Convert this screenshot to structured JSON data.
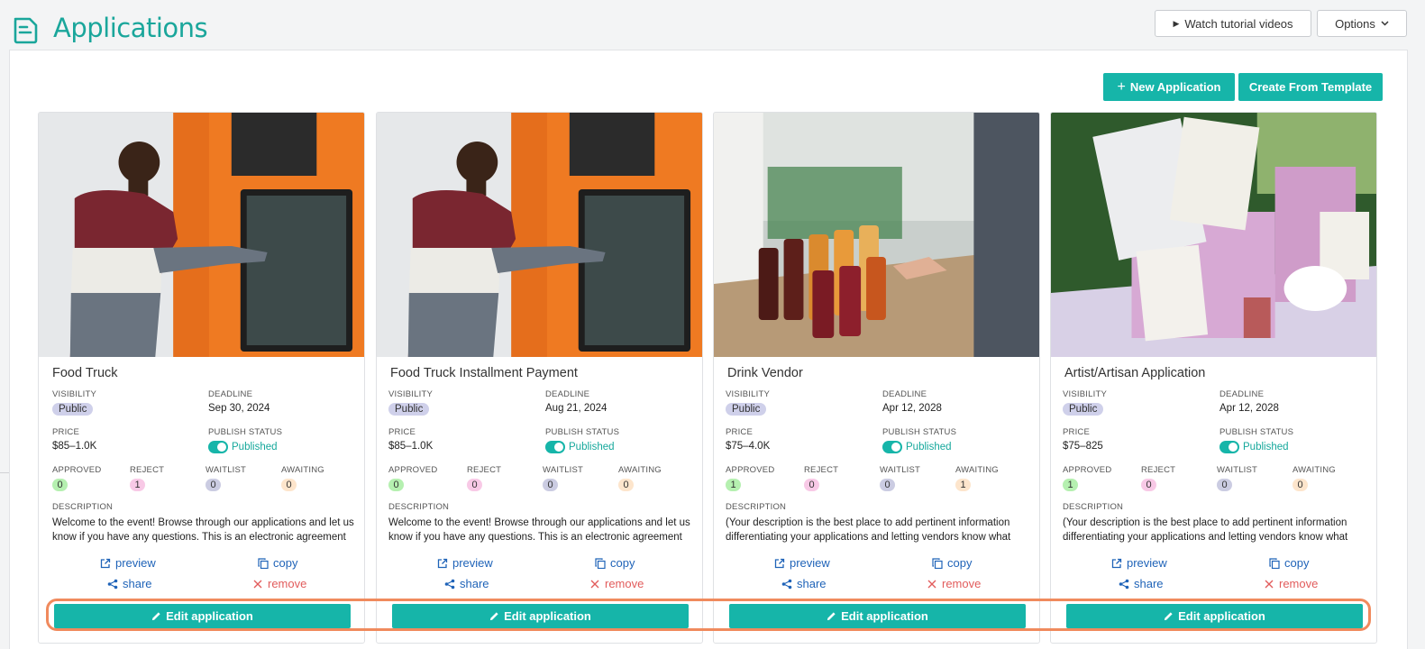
{
  "header": {
    "title": "Applications",
    "tutorial_label": "Watch tutorial videos",
    "options_label": "Options"
  },
  "toolbar": {
    "new_application_label": "New Application",
    "create_template_label": "Create From Template"
  },
  "labels": {
    "visibility": "VISIBILITY",
    "deadline": "DEADLINE",
    "price": "PRICE",
    "publish_status": "PUBLISH STATUS",
    "approved": "APPROVED",
    "reject": "REJECT",
    "waitlist": "WAITLIST",
    "awaiting": "AWAITING",
    "description": "DESCRIPTION",
    "preview": "preview",
    "copy": "copy",
    "share": "share",
    "remove": "remove",
    "edit": "Edit application"
  },
  "colors": {
    "accent": "#16b5a9",
    "title_teal": "#1aa69b",
    "link_blue": "#1f63b8",
    "remove_red": "#e25c5c",
    "highlight": "#f08a5d"
  },
  "cards": [
    {
      "title": "Food Truck",
      "visibility": "Public",
      "deadline": "Sep 30, 2024",
      "price": "$85–1.0K",
      "publish_status": "Published",
      "approved": "0",
      "reject": "1",
      "waitlist": "0",
      "awaiting": "0",
      "description": "Welcome to the event! Browse through our applications and let us know if you have any questions. This is an electronic agreement",
      "image": "food-truck-kiosk"
    },
    {
      "title": "Food Truck Installment Payment",
      "visibility": "Public",
      "deadline": "Aug 21, 2024",
      "price": "$85–1.0K",
      "publish_status": "Published",
      "approved": "0",
      "reject": "0",
      "waitlist": "0",
      "awaiting": "0",
      "description": "Welcome to the event! Browse through our applications and let us know if you have any questions. This is an electronic agreement",
      "image": "food-truck-kiosk"
    },
    {
      "title": "Drink Vendor",
      "visibility": "Public",
      "deadline": "Apr 12, 2028",
      "price": "$75–4.0K",
      "publish_status": "Published",
      "approved": "1",
      "reject": "0",
      "waitlist": "0",
      "awaiting": "1",
      "description": "(Your description is the best place to add pertinent information differentiating your applications and letting vendors know what",
      "image": "juice-bottles"
    },
    {
      "title": "Artist/Artisan Application",
      "visibility": "Public",
      "deadline": "Apr 12, 2028",
      "price": "$75–825",
      "publish_status": "Published",
      "approved": "1",
      "reject": "0",
      "waitlist": "0",
      "awaiting": "0",
      "description": "(Your description is the best place to add pertinent information differentiating your applications and letting vendors know what",
      "image": "artisan-stand"
    }
  ]
}
